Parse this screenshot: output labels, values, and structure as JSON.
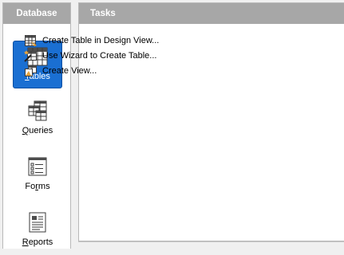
{
  "database_panel": {
    "title": "Database",
    "items": [
      {
        "label_key": "T",
        "label_rest": "ables",
        "icon": "table-icon",
        "selected": true
      },
      {
        "label_key": "Q",
        "label_rest": "ueries",
        "icon": "query-icon",
        "selected": false
      },
      {
        "label_pre": "Fo",
        "label_key": "r",
        "label_rest": "ms",
        "icon": "form-icon",
        "selected": false
      },
      {
        "label_key": "R",
        "label_rest": "eports",
        "icon": "report-icon",
        "selected": false
      }
    ]
  },
  "tasks_panel": {
    "title": "Tasks",
    "items": [
      {
        "label": "Create Table in Design View...",
        "icon": "table-design-icon"
      },
      {
        "label": "Use Wizard to Create Table...",
        "icon": "wizard-wand-icon"
      },
      {
        "label": "Create View...",
        "icon": "create-view-icon"
      }
    ]
  },
  "colors": {
    "header_bg": "#a7a7a7",
    "selected_bg": "#1a6fd2",
    "window_bg": "#f0f0f0"
  }
}
